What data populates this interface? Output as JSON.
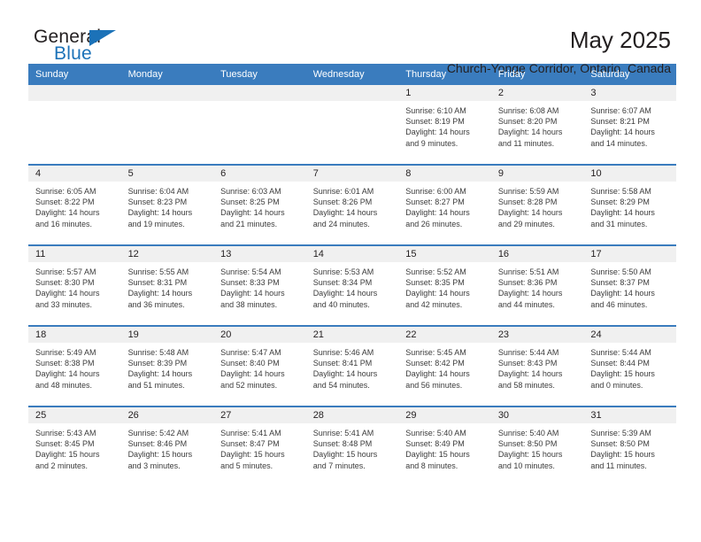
{
  "brand": {
    "name_part1": "General",
    "name_part2": "Blue",
    "triangle_color": "#1c72b8"
  },
  "header": {
    "title": "May 2025",
    "subtitle": "Church-Yonge Corridor, Ontario, Canada"
  },
  "theme": {
    "header_bg": "#3a7cbe",
    "header_text": "#ffffff",
    "daynum_bg": "#f0f0f0",
    "cell_bg": "#ffffff",
    "body_text": "#3b3b3b"
  },
  "weekday_headers": [
    "Sunday",
    "Monday",
    "Tuesday",
    "Wednesday",
    "Thursday",
    "Friday",
    "Saturday"
  ],
  "weeks": [
    [
      {
        "day": "",
        "lines": []
      },
      {
        "day": "",
        "lines": []
      },
      {
        "day": "",
        "lines": []
      },
      {
        "day": "",
        "lines": []
      },
      {
        "day": "1",
        "lines": [
          "Sunrise: 6:10 AM",
          "Sunset: 8:19 PM",
          "Daylight: 14 hours",
          "and 9 minutes."
        ]
      },
      {
        "day": "2",
        "lines": [
          "Sunrise: 6:08 AM",
          "Sunset: 8:20 PM",
          "Daylight: 14 hours",
          "and 11 minutes."
        ]
      },
      {
        "day": "3",
        "lines": [
          "Sunrise: 6:07 AM",
          "Sunset: 8:21 PM",
          "Daylight: 14 hours",
          "and 14 minutes."
        ]
      }
    ],
    [
      {
        "day": "4",
        "lines": [
          "Sunrise: 6:05 AM",
          "Sunset: 8:22 PM",
          "Daylight: 14 hours",
          "and 16 minutes."
        ]
      },
      {
        "day": "5",
        "lines": [
          "Sunrise: 6:04 AM",
          "Sunset: 8:23 PM",
          "Daylight: 14 hours",
          "and 19 minutes."
        ]
      },
      {
        "day": "6",
        "lines": [
          "Sunrise: 6:03 AM",
          "Sunset: 8:25 PM",
          "Daylight: 14 hours",
          "and 21 minutes."
        ]
      },
      {
        "day": "7",
        "lines": [
          "Sunrise: 6:01 AM",
          "Sunset: 8:26 PM",
          "Daylight: 14 hours",
          "and 24 minutes."
        ]
      },
      {
        "day": "8",
        "lines": [
          "Sunrise: 6:00 AM",
          "Sunset: 8:27 PM",
          "Daylight: 14 hours",
          "and 26 minutes."
        ]
      },
      {
        "day": "9",
        "lines": [
          "Sunrise: 5:59 AM",
          "Sunset: 8:28 PM",
          "Daylight: 14 hours",
          "and 29 minutes."
        ]
      },
      {
        "day": "10",
        "lines": [
          "Sunrise: 5:58 AM",
          "Sunset: 8:29 PM",
          "Daylight: 14 hours",
          "and 31 minutes."
        ]
      }
    ],
    [
      {
        "day": "11",
        "lines": [
          "Sunrise: 5:57 AM",
          "Sunset: 8:30 PM",
          "Daylight: 14 hours",
          "and 33 minutes."
        ]
      },
      {
        "day": "12",
        "lines": [
          "Sunrise: 5:55 AM",
          "Sunset: 8:31 PM",
          "Daylight: 14 hours",
          "and 36 minutes."
        ]
      },
      {
        "day": "13",
        "lines": [
          "Sunrise: 5:54 AM",
          "Sunset: 8:33 PM",
          "Daylight: 14 hours",
          "and 38 minutes."
        ]
      },
      {
        "day": "14",
        "lines": [
          "Sunrise: 5:53 AM",
          "Sunset: 8:34 PM",
          "Daylight: 14 hours",
          "and 40 minutes."
        ]
      },
      {
        "day": "15",
        "lines": [
          "Sunrise: 5:52 AM",
          "Sunset: 8:35 PM",
          "Daylight: 14 hours",
          "and 42 minutes."
        ]
      },
      {
        "day": "16",
        "lines": [
          "Sunrise: 5:51 AM",
          "Sunset: 8:36 PM",
          "Daylight: 14 hours",
          "and 44 minutes."
        ]
      },
      {
        "day": "17",
        "lines": [
          "Sunrise: 5:50 AM",
          "Sunset: 8:37 PM",
          "Daylight: 14 hours",
          "and 46 minutes."
        ]
      }
    ],
    [
      {
        "day": "18",
        "lines": [
          "Sunrise: 5:49 AM",
          "Sunset: 8:38 PM",
          "Daylight: 14 hours",
          "and 48 minutes."
        ]
      },
      {
        "day": "19",
        "lines": [
          "Sunrise: 5:48 AM",
          "Sunset: 8:39 PM",
          "Daylight: 14 hours",
          "and 51 minutes."
        ]
      },
      {
        "day": "20",
        "lines": [
          "Sunrise: 5:47 AM",
          "Sunset: 8:40 PM",
          "Daylight: 14 hours",
          "and 52 minutes."
        ]
      },
      {
        "day": "21",
        "lines": [
          "Sunrise: 5:46 AM",
          "Sunset: 8:41 PM",
          "Daylight: 14 hours",
          "and 54 minutes."
        ]
      },
      {
        "day": "22",
        "lines": [
          "Sunrise: 5:45 AM",
          "Sunset: 8:42 PM",
          "Daylight: 14 hours",
          "and 56 minutes."
        ]
      },
      {
        "day": "23",
        "lines": [
          "Sunrise: 5:44 AM",
          "Sunset: 8:43 PM",
          "Daylight: 14 hours",
          "and 58 minutes."
        ]
      },
      {
        "day": "24",
        "lines": [
          "Sunrise: 5:44 AM",
          "Sunset: 8:44 PM",
          "Daylight: 15 hours",
          "and 0 minutes."
        ]
      }
    ],
    [
      {
        "day": "25",
        "lines": [
          "Sunrise: 5:43 AM",
          "Sunset: 8:45 PM",
          "Daylight: 15 hours",
          "and 2 minutes."
        ]
      },
      {
        "day": "26",
        "lines": [
          "Sunrise: 5:42 AM",
          "Sunset: 8:46 PM",
          "Daylight: 15 hours",
          "and 3 minutes."
        ]
      },
      {
        "day": "27",
        "lines": [
          "Sunrise: 5:41 AM",
          "Sunset: 8:47 PM",
          "Daylight: 15 hours",
          "and 5 minutes."
        ]
      },
      {
        "day": "28",
        "lines": [
          "Sunrise: 5:41 AM",
          "Sunset: 8:48 PM",
          "Daylight: 15 hours",
          "and 7 minutes."
        ]
      },
      {
        "day": "29",
        "lines": [
          "Sunrise: 5:40 AM",
          "Sunset: 8:49 PM",
          "Daylight: 15 hours",
          "and 8 minutes."
        ]
      },
      {
        "day": "30",
        "lines": [
          "Sunrise: 5:40 AM",
          "Sunset: 8:50 PM",
          "Daylight: 15 hours",
          "and 10 minutes."
        ]
      },
      {
        "day": "31",
        "lines": [
          "Sunrise: 5:39 AM",
          "Sunset: 8:50 PM",
          "Daylight: 15 hours",
          "and 11 minutes."
        ]
      }
    ]
  ]
}
